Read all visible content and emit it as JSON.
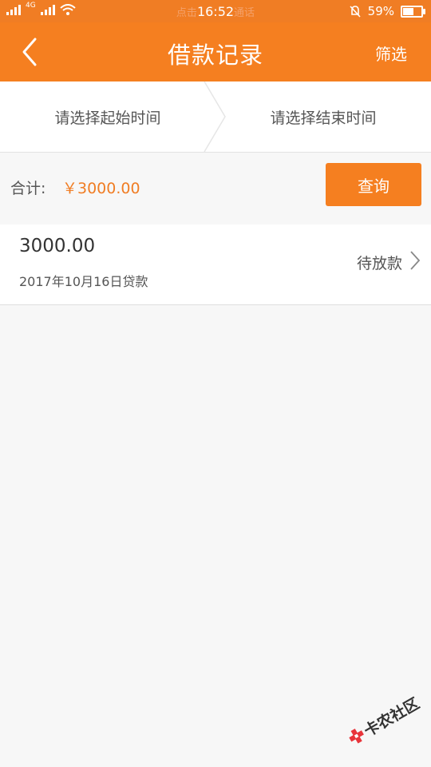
{
  "status_bar": {
    "hint_left": "点击",
    "time": "16:52",
    "hint_right": "通话",
    "battery": "59%",
    "battery_level": 0.59,
    "network": "4G"
  },
  "header": {
    "title": "借款记录",
    "filter_label": "筛选",
    "back_icon": "chevron-left-icon"
  },
  "date_range": {
    "start_placeholder": "请选择起始时间",
    "end_placeholder": "请选择结束时间"
  },
  "summary": {
    "total_label": "合计:",
    "total_value": "￥3000.00",
    "query_button": "查询"
  },
  "records": [
    {
      "amount": "3000.00",
      "date": "2017年10月16日贷款",
      "status": "待放款"
    }
  ],
  "watermark": {
    "text": "卡农社区"
  },
  "colors": {
    "accent": "#f57f20",
    "amount_highlight": "#f07d24",
    "background": "#f7f7f7"
  }
}
